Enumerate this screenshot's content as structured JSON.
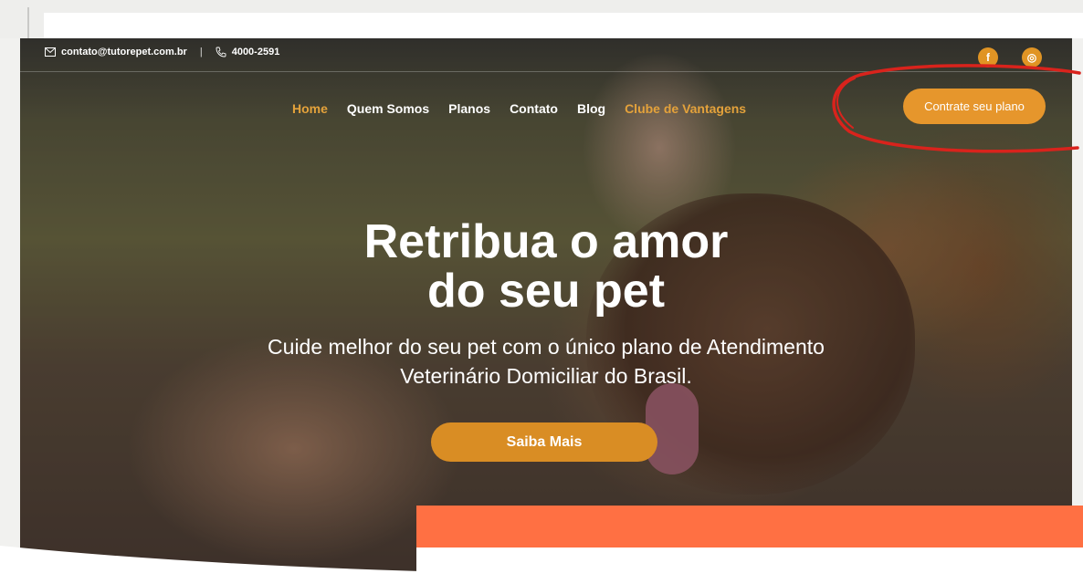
{
  "topbar": {
    "email": "contato@tutorepet.com.br",
    "separator": "|",
    "phone": "4000-2591",
    "social": [
      {
        "icon": "facebook-icon",
        "glyph": "f"
      },
      {
        "icon": "instagram-icon",
        "glyph": "◎"
      }
    ]
  },
  "nav": {
    "items": [
      {
        "label": "Home",
        "state": "active"
      },
      {
        "label": "Quem Somos"
      },
      {
        "label": "Planos"
      },
      {
        "label": "Contato"
      },
      {
        "label": "Blog"
      },
      {
        "label": "Clube de Vantagens",
        "state": "highlighted"
      }
    ],
    "cta_label": "Contrate seu plano"
  },
  "hero": {
    "title_line1": "Retribua o amor",
    "title_line2": "do seu pet",
    "subtitle_line1": "Cuide melhor do seu pet com o único plano de Atendimento",
    "subtitle_line2": "Veterinário Domiciliar do Brasil.",
    "button_label": "Saiba Mais"
  },
  "colors": {
    "accent": "#e6962c",
    "nav_active": "#e4a23b",
    "orange_bar": "#ff7043",
    "annotation_red": "#d9231c"
  }
}
